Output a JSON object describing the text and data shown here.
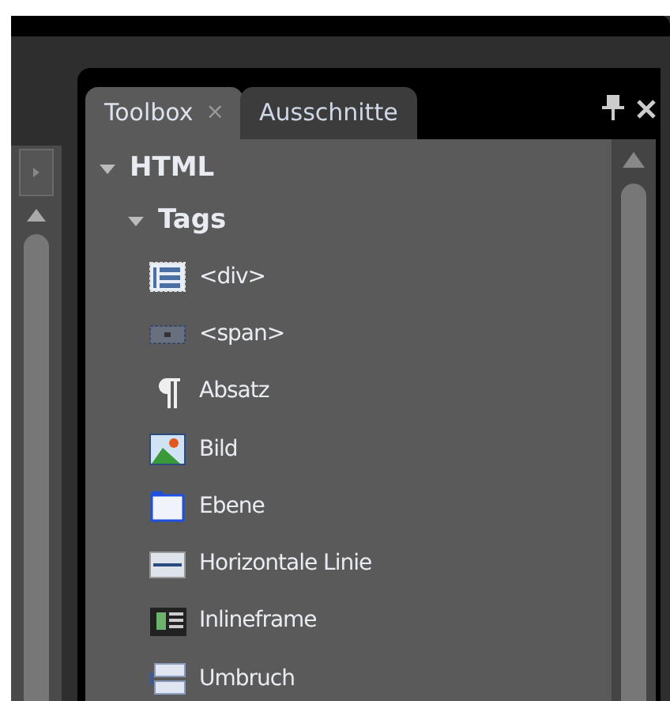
{
  "tabs": [
    {
      "label": "Toolbox",
      "selected": true,
      "close": "×"
    },
    {
      "label": "Ausschnitte",
      "selected": false
    }
  ],
  "tree": [
    {
      "label": "HTML",
      "expanded": true,
      "children": [
        {
          "label": "Tags",
          "expanded": true,
          "children": [
            {
              "label": "<div>",
              "kind": "div"
            },
            {
              "label": "<span>",
              "kind": "span"
            },
            {
              "label": "Absatz",
              "kind": "paragraph"
            },
            {
              "label": "Bild",
              "kind": "image"
            },
            {
              "label": "Ebene",
              "kind": "layer"
            },
            {
              "label": "Horizontale Linie",
              "kind": "rule"
            },
            {
              "label": "Inlineframe",
              "kind": "iframe"
            },
            {
              "label": "Umbruch",
              "kind": "break"
            }
          ]
        }
      ]
    }
  ]
}
